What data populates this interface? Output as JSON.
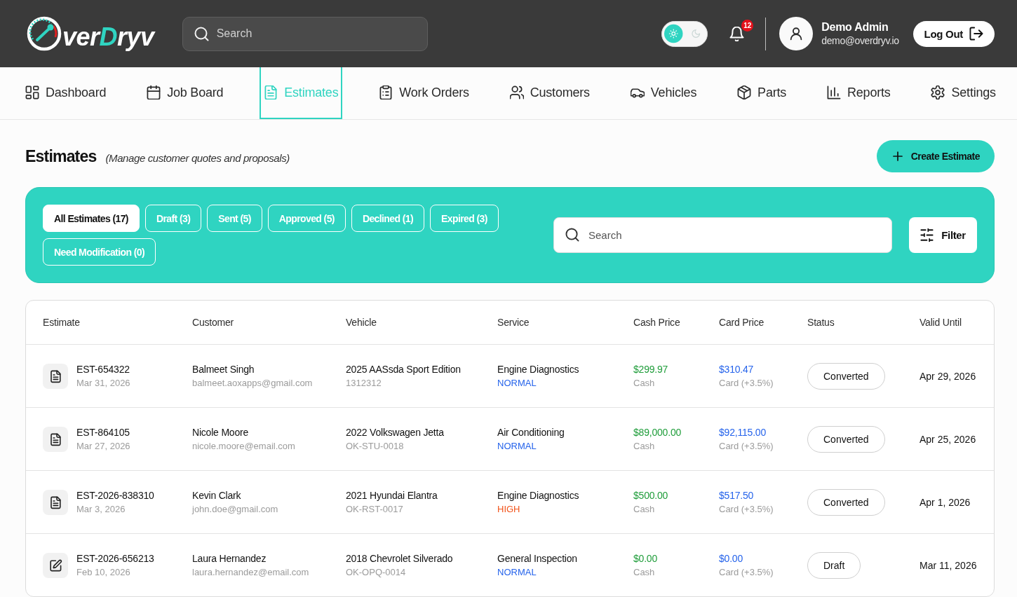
{
  "header": {
    "logo": {
      "parts": [
        {
          "text": "ver",
          "accent": false
        },
        {
          "text": "D",
          "accent": true
        },
        {
          "text": "ryv",
          "accent": false
        }
      ]
    },
    "search": {
      "placeholder": "Search"
    },
    "theme_toggle": {
      "options": [
        {
          "kind": "sun",
          "selected": true
        },
        {
          "kind": "moon",
          "selected": false
        }
      ]
    },
    "notifications": {
      "count": "12"
    },
    "user": {
      "name": "Demo Admin",
      "email": "demo@overdryv.io"
    },
    "logout_button": "Log Out"
  },
  "nav": [
    {
      "label": "Dashboard",
      "kind": "dashboard",
      "selected": false
    },
    {
      "label": "Job Board",
      "kind": "calendar",
      "selected": false
    },
    {
      "label": "Estimates",
      "kind": "document",
      "selected": true
    },
    {
      "label": "Work Orders",
      "kind": "clipboard",
      "selected": false
    },
    {
      "label": "Customers",
      "kind": "people",
      "selected": false
    },
    {
      "label": "Vehicles",
      "kind": "car",
      "selected": false
    },
    {
      "label": "Parts",
      "kind": "box",
      "selected": false
    },
    {
      "label": "Reports",
      "kind": "chart",
      "selected": false
    },
    {
      "label": "Settings",
      "kind": "gear",
      "selected": false
    }
  ],
  "page": {
    "title": "Estimates",
    "subtitle": "(Manage customer quotes and proposals)",
    "create_button": "Create Estimate"
  },
  "filters": {
    "tabs": [
      {
        "label": "All Estimates (17)",
        "selected": true
      },
      {
        "label": "Draft (3)",
        "selected": false
      },
      {
        "label": "Sent (5)",
        "selected": false
      },
      {
        "label": "Approved (5)",
        "selected": false
      },
      {
        "label": "Declined (1)",
        "selected": false
      },
      {
        "label": "Expired (3)",
        "selected": false
      },
      {
        "label": "Need Modification (0)",
        "selected": false
      }
    ],
    "search": {
      "placeholder": "Search"
    },
    "filter_button": "Filter"
  },
  "table": {
    "columns": [
      "Estimate",
      "Customer",
      "Vehicle",
      "Service",
      "Cash Price",
      "Card Price",
      "Status",
      "Valid Until"
    ],
    "rows": [
      {
        "kind": "document",
        "estimate": "EST-654322",
        "date": "Mar 31, 2026",
        "customer": "Balmeet Singh",
        "email": "balmeet.aoxapps@gmail.com",
        "vehicle": "2025 AASsda Sport Edition",
        "plate": "1312312",
        "service": "Engine Diagnostics",
        "priority": {
          "label": "NORMAL",
          "color": "#2563eb"
        },
        "cash": {
          "amount": "$299.97",
          "note": "Cash"
        },
        "card": {
          "amount": "$310.47",
          "note": "Card (+3.5%)"
        },
        "status": "Converted",
        "valid_until": "Apr 29, 2026"
      },
      {
        "kind": "document",
        "estimate": "EST-864105",
        "date": "Mar 27, 2026",
        "customer": "Nicole Moore",
        "email": "nicole.moore@email.com",
        "vehicle": "2022 Volkswagen Jetta",
        "plate": "OK-STU-0018",
        "service": "Air Conditioning",
        "priority": {
          "label": "NORMAL",
          "color": "#2563eb"
        },
        "cash": {
          "amount": "$89,000.00",
          "note": "Cash"
        },
        "card": {
          "amount": "$92,115.00",
          "note": "Card (+3.5%)"
        },
        "status": "Converted",
        "valid_until": "Apr 25, 2026"
      },
      {
        "kind": "document",
        "estimate": "EST-2026-838310",
        "date": "Mar 3, 2026",
        "customer": "Kevin Clark",
        "email": "john.doe@gmail.com",
        "vehicle": "2021 Hyundai Elantra",
        "plate": "OK-RST-0017",
        "service": "Engine Diagnostics",
        "priority": {
          "label": "HIGH",
          "color": "#f2541b"
        },
        "cash": {
          "amount": "$500.00",
          "note": "Cash"
        },
        "card": {
          "amount": "$517.50",
          "note": "Card (+3.5%)"
        },
        "status": "Converted",
        "valid_until": "Apr 1, 2026"
      },
      {
        "kind": "edit",
        "estimate": "EST-2026-656213",
        "date": "Feb 10, 2026",
        "customer": "Laura Hernandez",
        "email": "laura.hernandez@email.com",
        "vehicle": "2018 Chevrolet Silverado",
        "plate": "OK-OPQ-0014",
        "service": "General Inspection",
        "priority": {
          "label": "NORMAL",
          "color": "#2563eb"
        },
        "cash": {
          "amount": "$0.00",
          "note": "Cash"
        },
        "card": {
          "amount": "$0.00",
          "note": "Card (+3.5%)"
        },
        "status": "Draft",
        "valid_until": "Mar 11, 2026"
      }
    ]
  }
}
